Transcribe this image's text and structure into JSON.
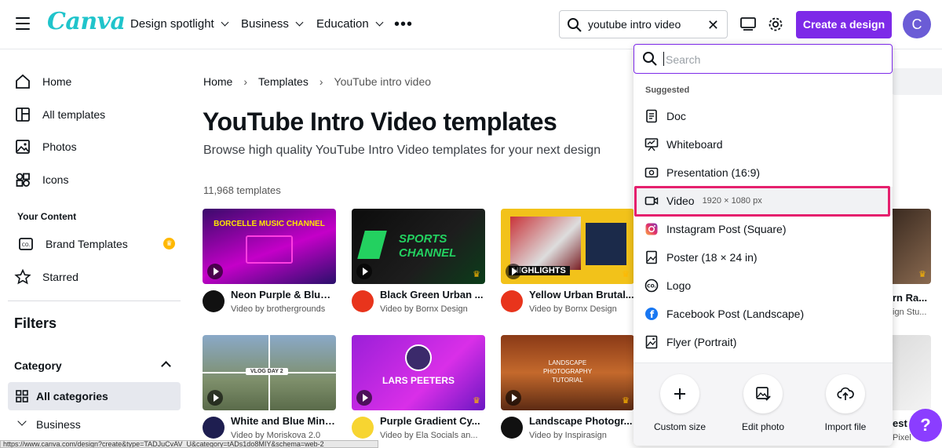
{
  "header": {
    "logo": "Canva",
    "nav": [
      "Design spotlight",
      "Business",
      "Education"
    ],
    "search_value": "youtube intro video",
    "create_label": "Create a design",
    "avatar_initial": "C"
  },
  "sidebar": {
    "items": [
      {
        "label": "Home",
        "icon": "home-icon"
      },
      {
        "label": "All templates",
        "icon": "templates-icon"
      },
      {
        "label": "Photos",
        "icon": "photo-icon"
      },
      {
        "label": "Icons",
        "icon": "shapes-icon"
      }
    ],
    "your_content_heading": "Your Content",
    "content_items": [
      {
        "label": "Brand Templates",
        "icon": "brand-icon"
      },
      {
        "label": "Starred",
        "icon": "star-icon"
      }
    ],
    "filters_heading": "Filters",
    "category_heading": "Category",
    "all_categories": "All categories",
    "business": "Business"
  },
  "main": {
    "breadcrumb": [
      "Home",
      "Templates",
      "YouTube intro video"
    ],
    "title": "YouTube Intro Video templates",
    "subtitle": "Browse high quality YouTube Intro Video templates for your next design",
    "count": "11,968 templates",
    "cards": [
      {
        "title": "Neon Purple & Blue ...",
        "by": "Video by brothergrounds",
        "thumb_text": "BORCELLE MUSIC CHANNEL"
      },
      {
        "title": "Black Green Urban ...",
        "by": "Video by Bornx Design",
        "thumb_text": "SPORTS CHANNEL"
      },
      {
        "title": "Yellow Urban Brutal...",
        "by": "Video by Bornx Design",
        "thumb_text": "HIGHLIGHTS"
      },
      {
        "title": "White and Blue Mini...",
        "by": "Video by Moriskova 2.0",
        "thumb_text": "VLOG DAY 2"
      },
      {
        "title": "Purple Gradient Cy...",
        "by": "Video by Ela Socials an...",
        "thumb_text": "LARS PEETERS"
      },
      {
        "title": "Landscape Photogr...",
        "by": "Video by Inspirasign",
        "thumb_text": "LANDSCAPE PHOTOGRAPHY TUTORIAL"
      }
    ],
    "partial_right": {
      "top_title": "rn Ra...",
      "top_by": "ign Stu...",
      "bottom_title": "est",
      "bottom_by": "Pixel"
    }
  },
  "dropdown": {
    "placeholder": "Search",
    "suggested_heading": "Suggested",
    "items": [
      {
        "label": "Doc",
        "sub": "",
        "icon": "doc-icon"
      },
      {
        "label": "Whiteboard",
        "sub": "",
        "icon": "whiteboard-icon"
      },
      {
        "label": "Presentation (16:9)",
        "sub": "",
        "icon": "presentation-icon"
      },
      {
        "label": "Video",
        "sub": "1920 × 1080 px",
        "icon": "video-icon"
      },
      {
        "label": "Instagram Post (Square)",
        "sub": "",
        "icon": "instagram-icon"
      },
      {
        "label": "Poster (18 × 24 in)",
        "sub": "",
        "icon": "poster-icon"
      },
      {
        "label": "Logo",
        "sub": "",
        "icon": "logo-icon"
      },
      {
        "label": "Facebook Post (Landscape)",
        "sub": "",
        "icon": "facebook-icon"
      },
      {
        "label": "Flyer (Portrait)",
        "sub": "",
        "icon": "flyer-icon"
      }
    ],
    "footer": [
      {
        "label": "Custom size",
        "icon": "plus-icon"
      },
      {
        "label": "Edit photo",
        "icon": "edit-photo-icon"
      },
      {
        "label": "Import file",
        "icon": "upload-icon"
      }
    ]
  },
  "help_label": "?",
  "status_url": "https://www.canva.com/design?create&type=TADJuCvAV_U&category=tADs1do8MIY&schema=web-2"
}
